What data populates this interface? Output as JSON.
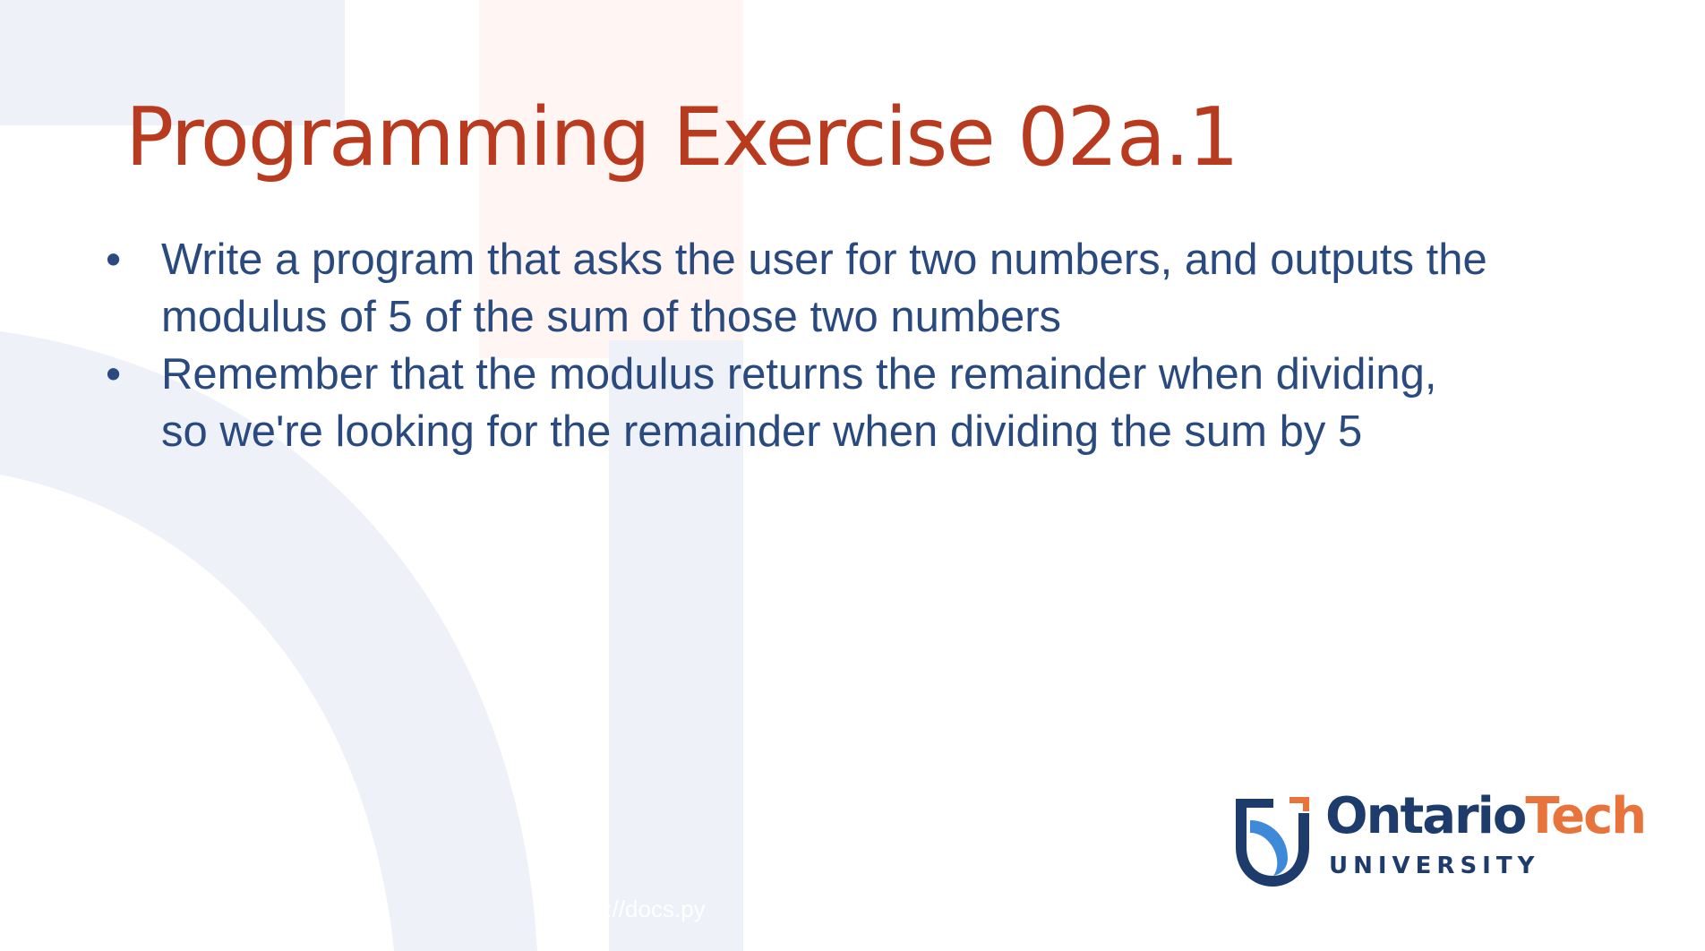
{
  "slide": {
    "title": "Programming Exercise 02a.1",
    "bullet_marker": "•",
    "bullets": [
      {
        "line1": "Write a program that asks the user for two numbers, and outputs the",
        "line2": "modulus of 5 of the sum of those two numbers"
      },
      {
        "line1": "Remember that the modulus returns the remainder when dividing,",
        "line2": "so we're looking for the remainder when dividing the sum by 5"
      }
    ],
    "footer_link": "https://docs.py"
  },
  "logo": {
    "word1": "Ontario",
    "word2": "Tech",
    "subline": "UNIVERSITY",
    "colors": {
      "navy": "#1d3b6b",
      "orange": "#e8743b",
      "light_blue": "#3f8ad8"
    }
  },
  "colors": {
    "title": "#b83b1f",
    "body": "#2a4a7f",
    "background_shapes": "#eef2f8"
  }
}
